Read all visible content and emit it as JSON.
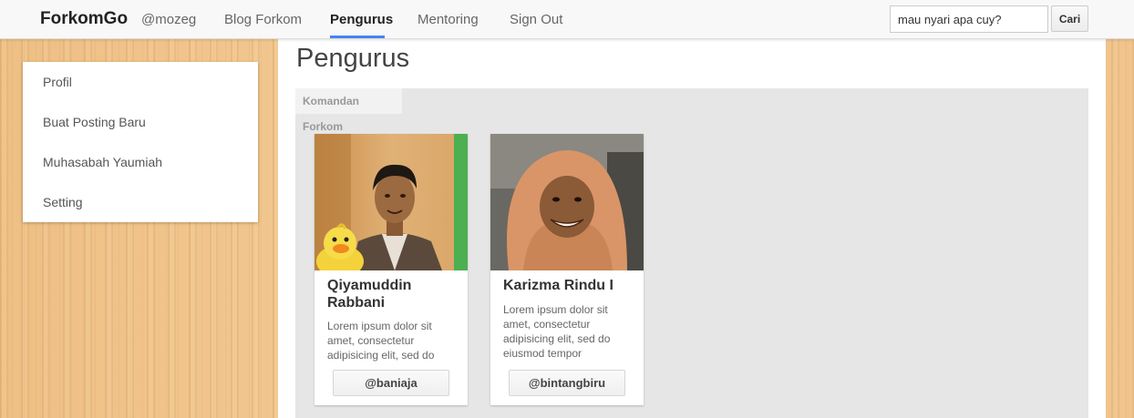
{
  "navbar": {
    "brand": "ForkomGo",
    "username": "@mozeg",
    "links": [
      "Blog Forkom",
      "Pengurus",
      "Mentoring",
      "Sign Out"
    ],
    "active_link": "Pengurus",
    "accent_color": "#4285f4"
  },
  "search": {
    "value": "mau nyari apa cuy?",
    "button_label": "Cari"
  },
  "sidebar": {
    "items": [
      {
        "label": "Profil"
      },
      {
        "label": "Buat Posting Baru"
      },
      {
        "label": "Muhasabah Yaumiah"
      },
      {
        "label": "Setting"
      }
    ]
  },
  "main": {
    "title": "Pengurus",
    "panel_tab": "Komandan Forkom",
    "members": [
      {
        "name": "Qiyamuddin Rabbani",
        "desc": "Lorem ipsum dolor sit amet, consectetur adipisicing elit, sed do",
        "handle": "@baniaja",
        "accent": "#4caf50"
      },
      {
        "name": "Karizma Rindu I",
        "desc": "Lorem ipsum dolor sit amet, consectetur adipisicing elit, sed do eiusmod tempor",
        "handle": "@bintangbiru"
      }
    ]
  }
}
